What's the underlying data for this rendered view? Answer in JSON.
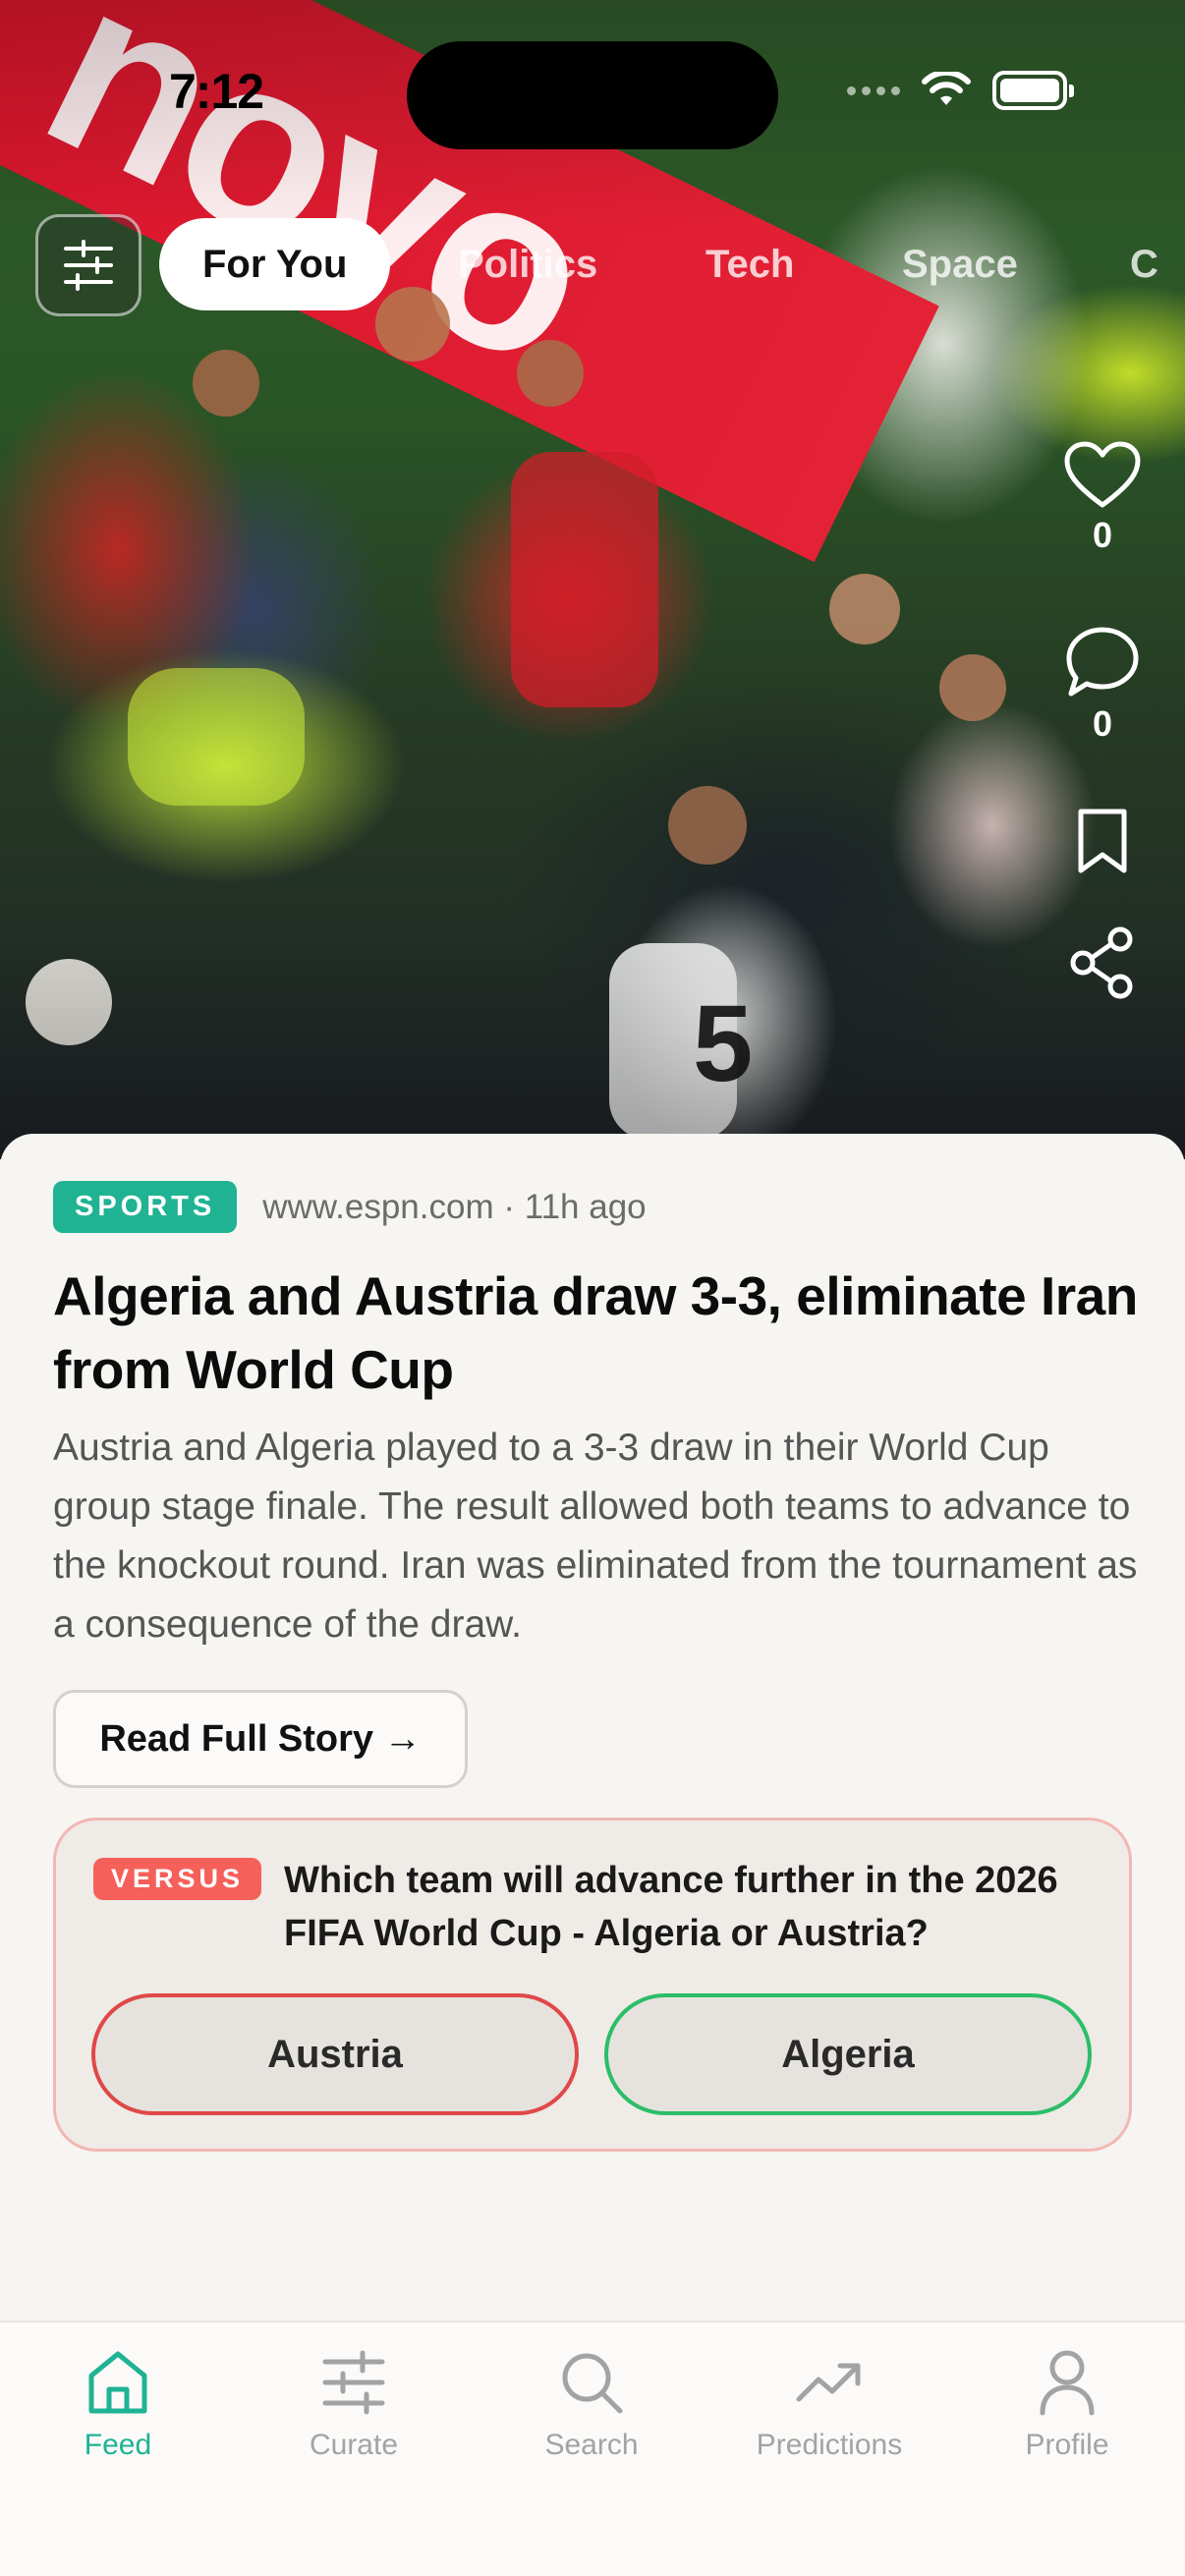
{
  "status_bar": {
    "time": "7:12"
  },
  "hero": {
    "banner_text": "novo"
  },
  "top_tabs": {
    "items": [
      {
        "label": "For You",
        "active": true
      },
      {
        "label": "Politics",
        "active": false
      },
      {
        "label": "Tech",
        "active": false
      },
      {
        "label": "Space",
        "active": false
      },
      {
        "label": "C",
        "active": false
      }
    ]
  },
  "side_actions": {
    "likes_count": "0",
    "comments_count": "0",
    "icons": [
      "heart-icon",
      "comment-icon",
      "bookmark-icon",
      "share-icon"
    ]
  },
  "article": {
    "category": "SPORTS",
    "meta": "www.espn.com · 11h ago",
    "headline": "Algeria and Austria draw 3-3, eliminate Iran from World Cup",
    "summary": "Austria and Algeria played to a 3-3 draw in their World Cup group stage finale. The result allowed both teams to advance to the knockout round. Iran was eliminated from the tournament as a consequence of the draw.",
    "read_more": "Read Full Story →"
  },
  "versus": {
    "badge": "VERSUS",
    "question": "Which team will advance further in the 2026 FIFA World Cup - Algeria or Austria?",
    "option_a": "Austria",
    "option_b": "Algeria"
  },
  "bottom_nav": {
    "items": [
      {
        "label": "Feed",
        "icon": "home-icon",
        "active": true
      },
      {
        "label": "Curate",
        "icon": "sliders-icon",
        "active": false
      },
      {
        "label": "Search",
        "icon": "search-icon",
        "active": false
      },
      {
        "label": "Predictions",
        "icon": "trending-icon",
        "active": false
      },
      {
        "label": "Profile",
        "icon": "user-icon",
        "active": false
      }
    ]
  },
  "colors": {
    "accent": "#1fb393",
    "versus_badge": "#f5605a",
    "option_a_border": "#e04848",
    "option_b_border": "#2dbd68"
  }
}
